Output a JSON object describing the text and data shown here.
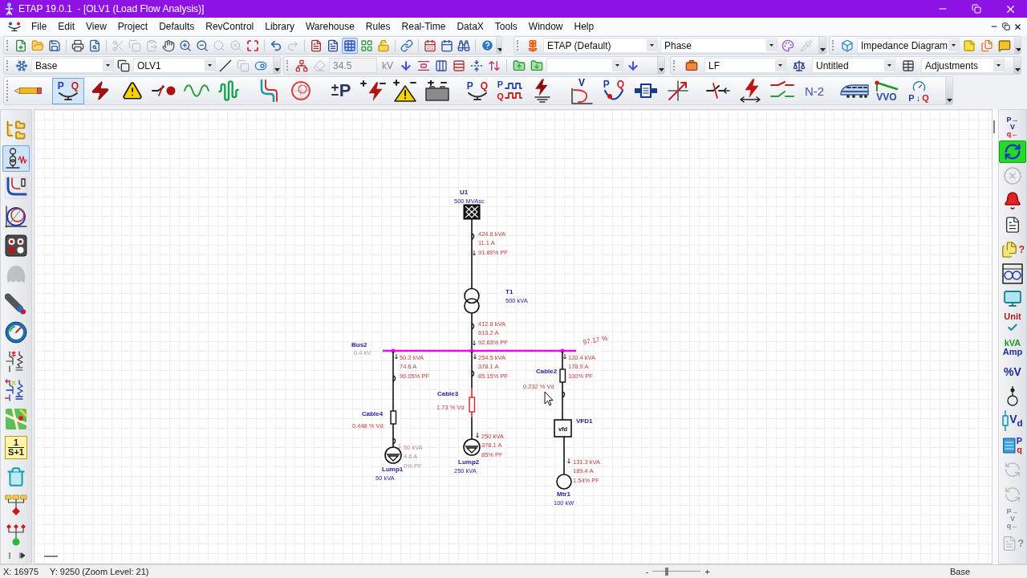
{
  "window": {
    "title": "ETAP 19.0.1  - [OLV1 (Load Flow Analysis)]"
  },
  "menu": [
    "File",
    "Edit",
    "View",
    "Project",
    "Defaults",
    "RevControl",
    "Library",
    "Warehouse",
    "Rules",
    "Real-Time",
    "DataX",
    "Tools",
    "Window",
    "Help"
  ],
  "toolbar_rows": [
    [
      {
        "items": [
          {
            "kind": "icon",
            "disabled": false,
            "selected": false
          },
          {
            "kind": "icon",
            "disabled": false,
            "selected": false
          },
          {
            "kind": "icon",
            "disabled": false,
            "selected": false
          },
          {
            "kind": "separator"
          },
          {
            "kind": "icon",
            "disabled": false,
            "selected": false
          },
          {
            "kind": "icon",
            "disabled": false,
            "selected": false
          },
          {
            "kind": "separator"
          },
          {
            "kind": "icon",
            "disabled": true,
            "selected": false
          },
          {
            "kind": "icon",
            "disabled": true,
            "selected": false
          },
          {
            "kind": "icon",
            "disabled": true,
            "selected": false
          },
          {
            "kind": "icon",
            "disabled": false,
            "selected": false
          },
          {
            "kind": "icon",
            "disabled": false,
            "selected": false
          },
          {
            "kind": "icon",
            "disabled": false,
            "selected": false
          },
          {
            "kind": "icon",
            "disabled": true,
            "selected": false
          },
          {
            "kind": "icon",
            "disabled": true,
            "selected": false
          },
          {
            "kind": "icon",
            "disabled": false,
            "selected": false
          },
          {
            "kind": "separator"
          },
          {
            "kind": "icon",
            "disabled": false,
            "selected": false
          },
          {
            "kind": "icon",
            "disabled": true,
            "selected": false
          },
          {
            "kind": "separator"
          },
          {
            "kind": "icon",
            "disabled": false,
            "selected": false
          },
          {
            "kind": "icon",
            "disabled": false,
            "selected": false
          },
          {
            "kind": "icon",
            "disabled": false,
            "selected": true
          },
          {
            "kind": "icon",
            "disabled": false,
            "selected": false
          },
          {
            "kind": "icon",
            "disabled": false,
            "selected": false
          },
          {
            "kind": "separator"
          },
          {
            "kind": "icon",
            "disabled": false,
            "selected": false
          },
          {
            "kind": "separator"
          },
          {
            "kind": "icon",
            "disabled": false,
            "selected": false
          },
          {
            "kind": "icon",
            "disabled": false,
            "selected": false
          },
          {
            "kind": "icon",
            "disabled": false,
            "selected": false
          },
          {
            "kind": "separator"
          },
          {
            "kind": "icon",
            "disabled": false,
            "selected": false
          }
        ]
      },
      {
        "items": [
          {
            "kind": "icon",
            "disabled": false,
            "selected": false
          },
          {
            "kind": "combo",
            "value": "ETAP (Default)"
          },
          {
            "kind": "combo",
            "value": "Phase"
          },
          {
            "kind": "icon",
            "disabled": false,
            "selected": false
          },
          {
            "kind": "icon",
            "disabled": true,
            "selected": false
          }
        ]
      },
      {
        "items": [
          {
            "kind": "icon",
            "disabled": false,
            "selected": false
          },
          {
            "kind": "combo",
            "value": "Impedance Diagram"
          },
          {
            "kind": "icon",
            "disabled": false,
            "selected": false
          },
          {
            "kind": "icon",
            "disabled": false,
            "selected": false
          },
          {
            "kind": "icon",
            "disabled": false,
            "selected": false
          }
        ]
      }
    ],
    [
      {
        "items": [
          {
            "kind": "icon",
            "disabled": false,
            "selected": false
          },
          {
            "kind": "combo",
            "value": "Base"
          },
          {
            "kind": "icon",
            "disabled": false,
            "selected": false
          },
          {
            "kind": "combo",
            "value": "OLV1"
          },
          {
            "kind": "icon",
            "disabled": false,
            "selected": false
          },
          {
            "kind": "icon",
            "disabled": true,
            "selected": false
          },
          {
            "kind": "icon",
            "disabled": false,
            "selected": false
          }
        ]
      },
      {
        "items": [
          {
            "kind": "icon",
            "disabled": false,
            "selected": false
          },
          {
            "kind": "icon",
            "disabled": true,
            "selected": false
          },
          {
            "kind": "field",
            "value": "34.5",
            "disabled": true
          },
          {
            "kind": "unit",
            "text": "kV",
            "disabled": true
          },
          {
            "kind": "icon",
            "disabled": false,
            "selected": false
          },
          {
            "kind": "icon",
            "disabled": false,
            "selected": false
          },
          {
            "kind": "icon",
            "disabled": false,
            "selected": false
          },
          {
            "kind": "icon",
            "disabled": false,
            "selected": false
          },
          {
            "kind": "icon",
            "disabled": false,
            "selected": false
          },
          {
            "kind": "icon",
            "disabled": false,
            "selected": false
          },
          {
            "kind": "separator"
          },
          {
            "kind": "icon",
            "disabled": false,
            "selected": false
          },
          {
            "kind": "icon",
            "disabled": false,
            "selected": false
          },
          {
            "kind": "combo"
          },
          {
            "kind": "icon",
            "disabled": false,
            "selected": false
          }
        ]
      },
      {
        "items": [
          {
            "kind": "icon",
            "disabled": false,
            "selected": false
          },
          {
            "kind": "combo",
            "value": "LF"
          },
          {
            "kind": "icon",
            "disabled": false,
            "selected": false
          },
          {
            "kind": "combo",
            "value": "Untitled"
          },
          {
            "kind": "icon",
            "disabled": false,
            "selected": false
          },
          {
            "kind": "combo",
            "value": "Adjustments"
          }
        ]
      }
    ]
  ],
  "mode_toolbar": {
    "groups": [
      [
        {
          "selected": false
        }
      ],
      [
        {
          "selected": true,
          "letters": [
            "P",
            "Q"
          ]
        },
        {
          "selected": false
        },
        {
          "selected": false
        },
        {
          "selected": false
        },
        {
          "selected": false
        },
        {
          "selected": false
        }
      ],
      [
        {
          "selected": false
        },
        {
          "selected": false
        }
      ],
      [
        {
          "selected": false,
          "letters": [
            "P"
          ]
        },
        {
          "selected": false
        },
        {
          "selected": false
        },
        {
          "selected": false
        }
      ],
      [
        {
          "selected": false,
          "letters": [
            "P",
            "Q"
          ]
        },
        {
          "selected": false,
          "letters": [
            "P",
            "Q"
          ]
        },
        {
          "selected": false
        }
      ],
      [
        {
          "selected": false,
          "letters": [
            "V"
          ]
        },
        {
          "selected": false,
          "letters": [
            "P",
            "Q"
          ]
        },
        {
          "selected": false
        },
        {
          "selected": false
        }
      ],
      [
        {
          "selected": false
        },
        {
          "selected": false
        },
        {
          "selected": false
        },
        {
          "selected": false,
          "letters": [
            "N-2"
          ]
        }
      ],
      [
        {
          "selected": false
        },
        {
          "selected": false,
          "letters": [
            "VVO"
          ]
        },
        {
          "selected": false,
          "letters": [
            "P",
            "↓",
            "Q"
          ]
        }
      ]
    ]
  },
  "view_toolbar": {
    "buttons": [
      {
        "selected": false,
        "disabled": false
      },
      {
        "selected": true,
        "disabled": false
      },
      {
        "selected": false,
        "disabled": false
      },
      {
        "selected": false,
        "disabled": false
      },
      {
        "selected": false,
        "disabled": false
      },
      {
        "selected": false,
        "disabled": true
      },
      {
        "selected": false,
        "disabled": false
      },
      {
        "selected": false,
        "disabled": false
      },
      {
        "selected": false,
        "disabled": false
      },
      {
        "selected": false,
        "disabled": false
      },
      {
        "selected": false,
        "disabled": false
      },
      {
        "selected": false,
        "disabled": false,
        "lines": [
          "1",
          "S+1"
        ]
      },
      {
        "selected": false,
        "disabled": false
      },
      {
        "selected": false,
        "disabled": false
      },
      {
        "selected": false,
        "disabled": false
      }
    ]
  },
  "study_toolbar": {
    "buttons": [
      {
        "selected": false,
        "disabled": false,
        "lines": [
          "P→",
          "V",
          "q←"
        ]
      },
      {
        "selected": true,
        "disabled": false
      },
      {
        "selected": false,
        "disabled": true
      },
      {
        "selected": false,
        "disabled": false
      },
      {
        "selected": false,
        "disabled": false
      },
      {
        "selected": false,
        "disabled": false,
        "lines": [
          "?"
        ]
      },
      {
        "selected": false,
        "disabled": false
      },
      {
        "selected": false,
        "disabled": false
      },
      {
        "selected": false,
        "disabled": false,
        "lines": [
          "Unit"
        ]
      },
      {
        "selected": false,
        "disabled": false,
        "lines": [
          "kVA",
          "Amp"
        ]
      },
      {
        "selected": false,
        "disabled": false,
        "lines": [
          "%V"
        ]
      },
      {
        "selected": false,
        "disabled": false
      },
      {
        "selected": false,
        "disabled": false,
        "lines": [
          "V$_{d}$"
        ]
      },
      {
        "selected": false,
        "disabled": false,
        "lines": [
          "P",
          "q"
        ]
      },
      {
        "selected": false,
        "disabled": true
      },
      {
        "selected": false,
        "disabled": true
      },
      {
        "selected": false,
        "disabled": true,
        "lines": [
          "P→",
          "V",
          "q←"
        ]
      },
      {
        "selected": false,
        "disabled": true,
        "lines": [
          "?"
        ]
      }
    ]
  },
  "diagram": {
    "utility": {
      "name": "U1",
      "rating": "500 MVAsc",
      "flow": [
        "424.8 kVA",
        "11.1 A",
        "91.89% PF"
      ]
    },
    "transformer": {
      "name": "T1",
      "rating": "500 kVA",
      "flow": [
        "412.8 kVA",
        "613.2 A",
        "92.63% PF"
      ]
    },
    "bus": {
      "name": "Bus2",
      "voltage": "0.4 kV",
      "result": "97.17 %"
    },
    "branches": [
      {
        "flow": [
          "50.2 kVA",
          "74.6 A",
          "90.05% PF"
        ],
        "cable": {
          "name": "Cable4",
          "drop": "0.448 % Vd",
          "highlighted": false
        },
        "load": {
          "kind": "lump",
          "name": "Lump1",
          "rating": "50 kVA",
          "flow": [
            "50 kVA",
            "4.6 A",
            "0% PF"
          ],
          "faded": true
        }
      },
      {
        "flow": [
          "254.5 kVA",
          "378.1 A",
          "85.15% PF"
        ],
        "cable": {
          "name": "Cable3",
          "drop": "1.73 % Vd",
          "highlighted": true
        },
        "load": {
          "kind": "lump",
          "name": "Lump2",
          "rating": "250 kVA",
          "flow": [
            "250 kVA",
            "378.1 A",
            "85% PF"
          ],
          "faded": false
        }
      },
      {
        "flow": [
          "120.4 kVA",
          "178.9 A",
          "100% PF"
        ],
        "cable": {
          "name": "Cable2",
          "drop": "0.232 % Vd",
          "highlighted": false
        },
        "drive": {
          "name": "VFD1",
          "symbol": "vfd"
        },
        "load": {
          "kind": "motor",
          "name": "Mtr1",
          "rating": "100 kW",
          "flow": [
            "131.3 kVA",
            "189.4 A",
            "1.54% PF"
          ],
          "faded": false
        }
      }
    ]
  },
  "status_bar": {
    "x": "X: 16975",
    "y": "Y: 9250 (Zoom Level: 21)",
    "zoom": {
      "decrease": "-",
      "increase": "+",
      "level": 0.3
    },
    "mode": "Base"
  }
}
